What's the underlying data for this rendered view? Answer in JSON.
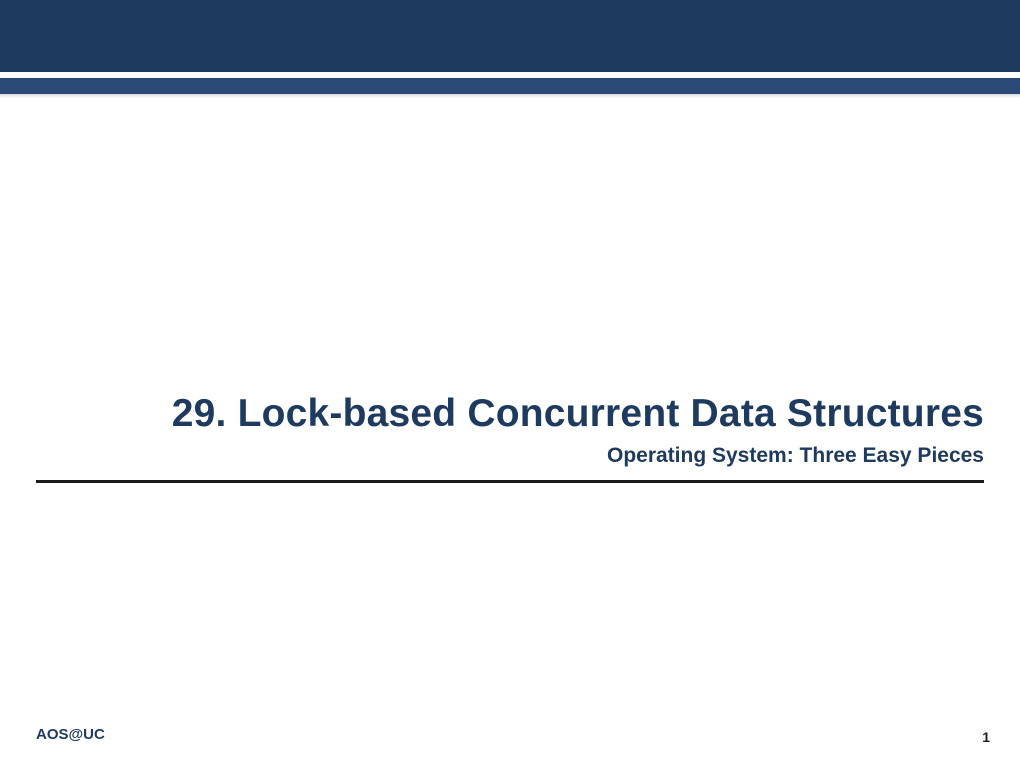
{
  "slide": {
    "title": "29. Lock-based Concurrent Data Structures",
    "subtitle": "Operating System: Three Easy Pieces"
  },
  "footer": {
    "left": "AOS@UC",
    "page_number": "1"
  }
}
